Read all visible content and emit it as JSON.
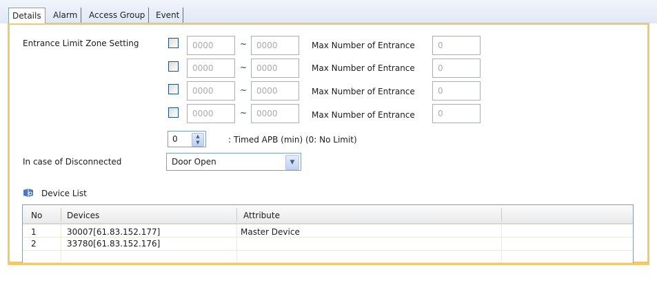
{
  "tabs": [
    {
      "label": "Details",
      "active": true
    },
    {
      "label": "Alarm",
      "active": false
    },
    {
      "label": "Access Group",
      "active": false
    },
    {
      "label": "Event",
      "active": false
    }
  ],
  "entrance_limit": {
    "label": "Entrance Limit Zone Setting",
    "rows": [
      {
        "checked": false,
        "from": "0000",
        "to": "0000",
        "max_label": "Max Number of Entrance",
        "max": "0"
      },
      {
        "checked": false,
        "from": "0000",
        "to": "0000",
        "max_label": "Max Number of Entrance",
        "max": "0"
      },
      {
        "checked": false,
        "from": "0000",
        "to": "0000",
        "max_label": "Max Number of Entrance",
        "max": "0"
      },
      {
        "checked": false,
        "from": "0000",
        "to": "0000",
        "max_label": "Max Number of Entrance",
        "max": "0"
      }
    ],
    "separator": "~"
  },
  "timed_apb": {
    "value": "0",
    "label": ": Timed APB (min)  (0: No Limit)"
  },
  "disconnected": {
    "label": "In case of Disconnected",
    "selected": "Door Open"
  },
  "device_list": {
    "title": "Device List",
    "icon": "device-list-icon",
    "columns": [
      "No",
      "Devices",
      "Attribute"
    ],
    "rows": [
      {
        "no": "1",
        "device": "30007[61.83.152.177]",
        "attribute": "Master Device"
      },
      {
        "no": "2",
        "device": "33780[61.83.152.176]",
        "attribute": ""
      }
    ]
  },
  "colors": {
    "panel_border": "#f0ca6a",
    "tab_strip": "#dfe8f6"
  }
}
